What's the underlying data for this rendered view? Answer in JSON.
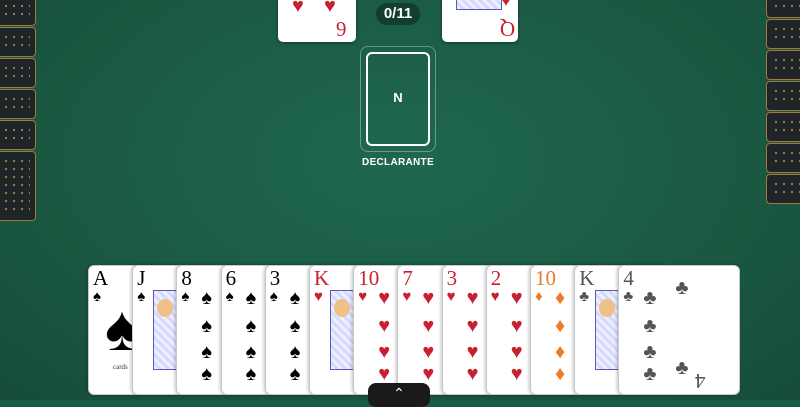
{
  "table": {
    "trick_counter": "0/11",
    "declarer_slot": {
      "letter": "N",
      "caption": "DECLARANTE"
    }
  },
  "top_cards": [
    {
      "rank": "6",
      "suit": "♥",
      "color": "#c8202e"
    },
    {
      "rank": "Q",
      "suit": "♥",
      "color": "#c8202e"
    }
  ],
  "hand": [
    {
      "rank": "A",
      "suit": "♠",
      "color": "#000000",
      "face": "ace",
      "brand": "cards"
    },
    {
      "rank": "J",
      "suit": "♠",
      "color": "#000000",
      "face": "court"
    },
    {
      "rank": "8",
      "suit": "♠",
      "color": "#000000",
      "face": "pips"
    },
    {
      "rank": "6",
      "suit": "♠",
      "color": "#000000",
      "face": "pips"
    },
    {
      "rank": "3",
      "suit": "♠",
      "color": "#000000",
      "face": "pips"
    },
    {
      "rank": "K",
      "suit": "♥",
      "color": "#c8202e",
      "face": "court"
    },
    {
      "rank": "10",
      "suit": "♥",
      "color": "#c8202e",
      "face": "pips"
    },
    {
      "rank": "7",
      "suit": "♥",
      "color": "#c8202e",
      "face": "pips"
    },
    {
      "rank": "3",
      "suit": "♥",
      "color": "#c8202e",
      "face": "pips"
    },
    {
      "rank": "2",
      "suit": "♥",
      "color": "#c8202e",
      "face": "pips"
    },
    {
      "rank": "10",
      "suit": "♦",
      "color": "#ef7a26",
      "face": "pips"
    },
    {
      "rank": "K",
      "suit": "♣",
      "color": "#555555",
      "face": "court"
    },
    {
      "rank": "4",
      "suit": "♣",
      "color": "#555555",
      "face": "pips"
    }
  ],
  "opponent_left_cards": 6,
  "opponent_right_cards": 7,
  "hand_toggle_icon": "chevron-up-icon"
}
